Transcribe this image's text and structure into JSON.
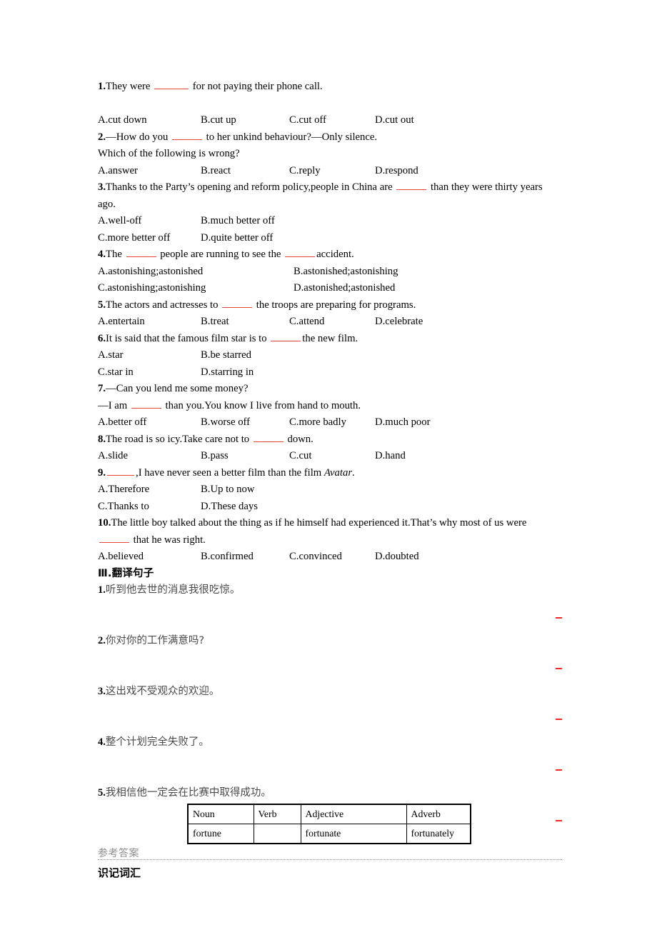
{
  "document": {
    "multiple_choice": {
      "questions": [
        {
          "number": "1.",
          "stem_before": "They were",
          "stem_after": "for not paying their phone call.",
          "layout": "4across",
          "options": [
            "A.cut down",
            "B.cut up",
            "C.cut off",
            "D.cut out"
          ]
        },
        {
          "number": "2.",
          "stem_before": "—How do you",
          "stem_after": "to her unkind behaviour?—Only silence.",
          "extra_line": "Which of the following is wrong?",
          "layout": "4across",
          "options": [
            "A.answer",
            "B.react",
            "C.reply",
            "D.respond"
          ]
        },
        {
          "number": "3.",
          "stem_before": "Thanks to the Party’s opening and reform policy,people in China are",
          "stem_after": "than they were thirty years ago.",
          "layout": "2narrow",
          "options": [
            "A.well-off",
            "B.much better off",
            "C.more better off",
            "D.quite better off"
          ]
        },
        {
          "number": "4.",
          "stem_before": "The",
          "stem_mid": "people are running to see the",
          "stem_after": "accident.",
          "layout": "2wide",
          "options": [
            "A.astonishing;astonished",
            "B.astonished;astonishing",
            "C.astonishing;astonishing",
            "D.astonished;astonished"
          ]
        },
        {
          "number": "5.",
          "stem_before": "The actors and actresses to",
          "stem_after": "the troops are preparing for programs.",
          "layout": "4across",
          "options": [
            "A.entertain",
            "B.treat",
            "C.attend",
            "D.celebrate"
          ]
        },
        {
          "number": "6.",
          "stem_before": "It is said that the famous film star is to",
          "stem_after": "the new film.",
          "layout": "2narrow",
          "options": [
            "A.star",
            "B.be starred",
            "C.star in",
            "D.starring in"
          ]
        },
        {
          "number": "7.",
          "stem_before": "—Can you lend me some money?",
          "dialogue_line_before": "—I am",
          "dialogue_line_after": "than you.You know I live from hand to mouth.",
          "layout": "4across",
          "options": [
            "A.better off",
            "B.worse off",
            "C.more badly",
            "D.much poor"
          ]
        },
        {
          "number": "8.",
          "stem_before": "The road is so icy.Take care not to",
          "stem_after": "down.",
          "layout": "4across",
          "options": [
            "A.slide",
            "B.pass",
            "C.cut",
            "D.hand"
          ]
        },
        {
          "number": "9.",
          "stem_before": "",
          "stem_after_plain": ",I have never seen a better film than the film",
          "stem_italic": "Avatar",
          "stem_tail": ".",
          "layout": "2narrow",
          "options": [
            "A.Therefore",
            "B.Up to now",
            "C.Thanks to",
            "D.These days"
          ]
        },
        {
          "number": "10.",
          "stem_before": "The little boy talked about the thing as if he himself had experienced it.That’s why most of us were",
          "stem_after": "that he was right.",
          "layout": "4across",
          "options": [
            "A.believed",
            "B.confirmed",
            "C.convinced",
            "D.doubted"
          ]
        }
      ]
    },
    "translation_section": {
      "heading_numeral": "Ⅲ",
      "heading_dot": ".",
      "heading_title": "翻译句子",
      "sentences": [
        {
          "number": "1.",
          "text": "听到他去世的消息我很吃惊。"
        },
        {
          "number": "2.",
          "text": "你对你的工作满意吗?"
        },
        {
          "number": "3.",
          "text": "这出戏不受观众的欢迎。"
        },
        {
          "number": "4.",
          "text": "整个计划完全失败了。"
        },
        {
          "number": "5.",
          "text": "我相信他一定会在比赛中取得成功。"
        }
      ]
    },
    "answer_key": {
      "label": "参考答案",
      "subheading": "识记词汇",
      "word_form_table": {
        "headers": [
          "Noun",
          "Verb",
          "Adjective",
          "Adverb"
        ],
        "rows": [
          [
            "fortune",
            "",
            "fortunate",
            "fortunately"
          ]
        ]
      }
    },
    "colors": {
      "blank_underline": "#e8413a",
      "answer_dash": "#ee2a24",
      "key_label": "#8e8e8e",
      "chinese_text": "#4a4a4a"
    }
  }
}
